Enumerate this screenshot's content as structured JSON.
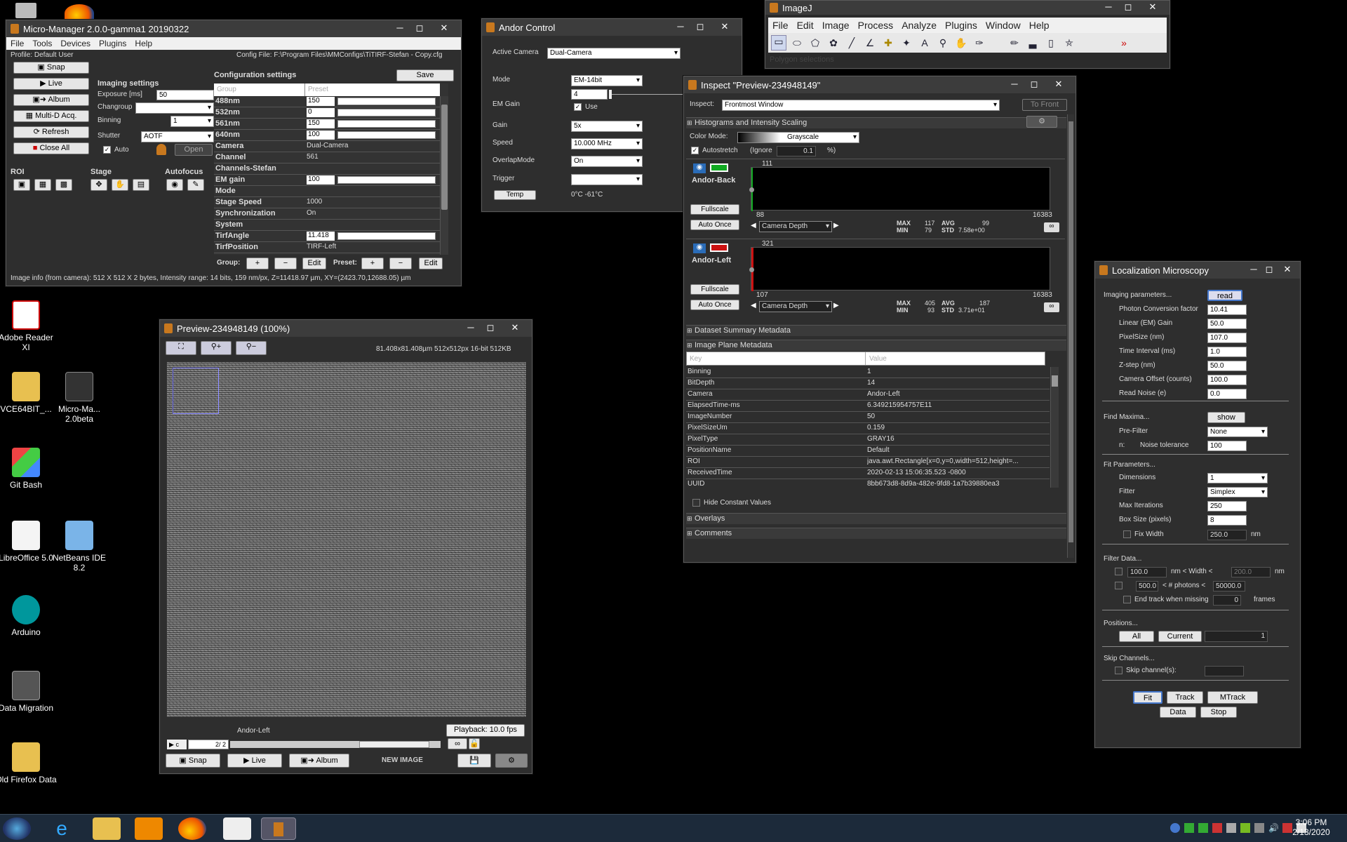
{
  "desktop": {
    "icons": [
      {
        "label": "Adobe Reader XI"
      },
      {
        "label": "VCE64BIT_..."
      },
      {
        "label": "Micro-Ma... 2.0beta"
      },
      {
        "label": "Git Bash"
      },
      {
        "label": "LibreOffice 5.0"
      },
      {
        "label": "NetBeans IDE 8.2"
      },
      {
        "label": "Arduino"
      },
      {
        "label": "Data Migration"
      },
      {
        "label": "Old Firefox Data"
      }
    ]
  },
  "micromanager": {
    "title": "Micro-Manager 2.0.0-gamma1 20190322",
    "menu": [
      "File",
      "Tools",
      "Devices",
      "Plugins",
      "Help"
    ],
    "profile": "Profile: Default User",
    "config_file": "Config File: F:\\Program Files\\MMConfigs\\TiTIRF-Stefan - Copy.cfg",
    "buttons": {
      "snap": "Snap",
      "live": "Live",
      "album": "Album",
      "multid": "Multi-D Acq.",
      "refresh": "Refresh",
      "close_all": "Close All"
    },
    "imaging_settings": "Imaging settings",
    "exposure_label": "Exposure [ms]",
    "exposure_value": "50",
    "changroup_label": "Changroup",
    "binning_label": "Binning",
    "binning_value": "1",
    "shutter_label": "Shutter",
    "shutter_value": "AOTF",
    "auto_label": "Auto",
    "open_label": "Open",
    "roi_label": "ROI",
    "stage_label": "Stage",
    "autofocus_label": "Autofocus",
    "config_settings": "Configuration settings",
    "save": "Save",
    "col_group": "Group",
    "col_preset": "Preset",
    "rows": [
      {
        "group": "488nm",
        "preset": "150"
      },
      {
        "group": "532nm",
        "preset": "0"
      },
      {
        "group": "561nm",
        "preset": "150"
      },
      {
        "group": "640nm",
        "preset": "100"
      },
      {
        "group": "Camera",
        "preset": "Dual-Camera"
      },
      {
        "group": "Channel",
        "preset": "561"
      },
      {
        "group": "Channels-Stefan",
        "preset": ""
      },
      {
        "group": "EM gain",
        "preset": "100"
      },
      {
        "group": "Mode",
        "preset": ""
      },
      {
        "group": "Stage Speed",
        "preset": "1000"
      },
      {
        "group": "Synchronization",
        "preset": "On"
      },
      {
        "group": "System",
        "preset": ""
      },
      {
        "group": "TirfAngle",
        "preset": "11.418"
      },
      {
        "group": "TirfPosition",
        "preset": "TIRF-Left"
      }
    ],
    "group_label": "Group:",
    "preset_label": "Preset:",
    "edit": "Edit",
    "plus": "+",
    "minus": "−",
    "status": "Image info (from camera): 512 X 512 X 2 bytes, Intensity range: 14 bits, 159 nm/px, Z=11418.97 µm, XY=(2423.70,12688.05) µm"
  },
  "andor": {
    "title": "Andor Control",
    "active_camera_label": "Active Camera",
    "active_camera": "Dual-Camera",
    "mode_label": "Mode",
    "mode": "EM-14bit",
    "emgain_label": "EM Gain",
    "emgain": "4",
    "use_label": "Use",
    "gain_label": "Gain",
    "gain": "5x",
    "speed_label": "Speed",
    "speed": "10.000 MHz",
    "overlap_label": "OverlapMode",
    "overlap": "On",
    "trigger_label": "Trigger",
    "temp_btn": "Temp",
    "temp_value": "0°C  -61°C"
  },
  "imagej": {
    "title": "ImageJ",
    "menu": [
      "File",
      "Edit",
      "Image",
      "Process",
      "Analyze",
      "Plugins",
      "Window",
      "Help"
    ],
    "status": "Polygon selections"
  },
  "inspect": {
    "title": "Inspect \"Preview-234948149\"",
    "inspect_label": "Inspect:",
    "inspect_value": "Frontmost Window",
    "to_front": "To Front",
    "hist_section": "Histograms and Intensity Scaling",
    "color_mode_label": "Color Mode:",
    "color_mode": "Grayscale",
    "autostretch_label": "Autostretch",
    "ignore_label": "(Ignore",
    "ignore_value": "0.1",
    "pct": "%)",
    "channels": [
      {
        "name": "Andor-Back",
        "top": "111",
        "bottom": "88",
        "max_range": "16383",
        "max": "117",
        "min": "79",
        "avg": "99",
        "std": "7.58e+00",
        "fullscale": "Fullscale",
        "autoonce": "Auto Once",
        "depth": "Camera Depth"
      },
      {
        "name": "Andor-Left",
        "top": "321",
        "bottom": "107",
        "max_range": "16383",
        "max": "405",
        "min": "93",
        "avg": "187",
        "std": "3.71e+01",
        "fullscale": "Fullscale",
        "autoonce": "Auto Once",
        "depth": "Camera Depth"
      }
    ],
    "max_l": "MAX",
    "min_l": "MIN",
    "avg_l": "AVG",
    "std_l": "STD",
    "dataset_section": "Dataset Summary Metadata",
    "plane_section": "Image Plane Metadata",
    "key_col": "Key",
    "value_col": "Value",
    "metadata": [
      {
        "k": "Binning",
        "v": "1"
      },
      {
        "k": "BitDepth",
        "v": "14"
      },
      {
        "k": "Camera",
        "v": "Andor-Left"
      },
      {
        "k": "ElapsedTime-ms",
        "v": "6.349215954757E11"
      },
      {
        "k": "ImageNumber",
        "v": "50"
      },
      {
        "k": "PixelSizeUm",
        "v": "0.159"
      },
      {
        "k": "PixelType",
        "v": "GRAY16"
      },
      {
        "k": "PositionName",
        "v": "Default"
      },
      {
        "k": "ROI",
        "v": "java.awt.Rectangle[x=0,y=0,width=512,height=..."
      },
      {
        "k": "ReceivedTime",
        "v": "2020-02-13 15:06:35.523 -0800"
      },
      {
        "k": "UUID",
        "v": "8bb673d8-8d9a-482e-9fd8-1a7b39880ea3"
      }
    ],
    "hide_constant": "Hide Constant Values",
    "overlays": "Overlays",
    "comments": "Comments"
  },
  "preview": {
    "title": "Preview-234948149 (100%)",
    "info": "81.408x81.408µm  512x512px  16-bit 512KB",
    "channel_name": "Andor-Left",
    "playback": "Playback: 10.0 fps",
    "c_label": "c",
    "frame": "2/  2",
    "snap": "Snap",
    "live": "Live",
    "album": "Album",
    "new_image": "NEW IMAGE"
  },
  "loc": {
    "title": "Localization Microscopy",
    "imaging_params": "Imaging parameters...",
    "read": "read",
    "params": [
      {
        "label": "Photon Conversion factor",
        "value": "10.41"
      },
      {
        "label": "Linear (EM) Gain",
        "value": "50.0"
      },
      {
        "label": "PixelSize (nm)",
        "value": "107.0"
      },
      {
        "label": "Time Interval (ms)",
        "value": "1.0"
      },
      {
        "label": "Z-step (nm)",
        "value": "50.0"
      },
      {
        "label": "Camera Offset (counts)",
        "value": "100.0"
      },
      {
        "label": "Read Noise (e)",
        "value": "0.0"
      }
    ],
    "find_maxima": "Find Maxima...",
    "show": "show",
    "prefilter_label": "Pre-Filter",
    "prefilter": "None",
    "n_label": "n:",
    "noise_label": "Noise tolerance",
    "noise": "100",
    "fit_params": "Fit Parameters...",
    "dimensions_label": "Dimensions",
    "dimensions": "1",
    "fitter_label": "Fitter",
    "fitter": "Simplex",
    "max_iter_label": "Max Iterations",
    "max_iter": "250",
    "box_size_label": "Box Size (pixels)",
    "box_size": "8",
    "fix_width_label": "Fix Width",
    "fix_width": "250.0",
    "nm": "nm",
    "filter_data": "Filter Data...",
    "width_min": "100.0",
    "width_text": "nm < Width <",
    "width_max": "200.0",
    "photons_min": "500.0",
    "photons_text": "< # photons <",
    "photons_max": "50000.0",
    "end_track": "End track when missing",
    "end_track_val": "0",
    "frames": "frames",
    "positions": "Positions...",
    "all": "All",
    "current": "Current",
    "pos_val": "1",
    "skip_channels": "Skip Channels...",
    "skip_label": "Skip channel(s):",
    "fit": "Fit",
    "track": "Track",
    "mtrack": "MTrack",
    "data": "Data",
    "stop": "Stop"
  },
  "taskbar": {
    "time": "3:06 PM",
    "date": "2/13/2020"
  }
}
